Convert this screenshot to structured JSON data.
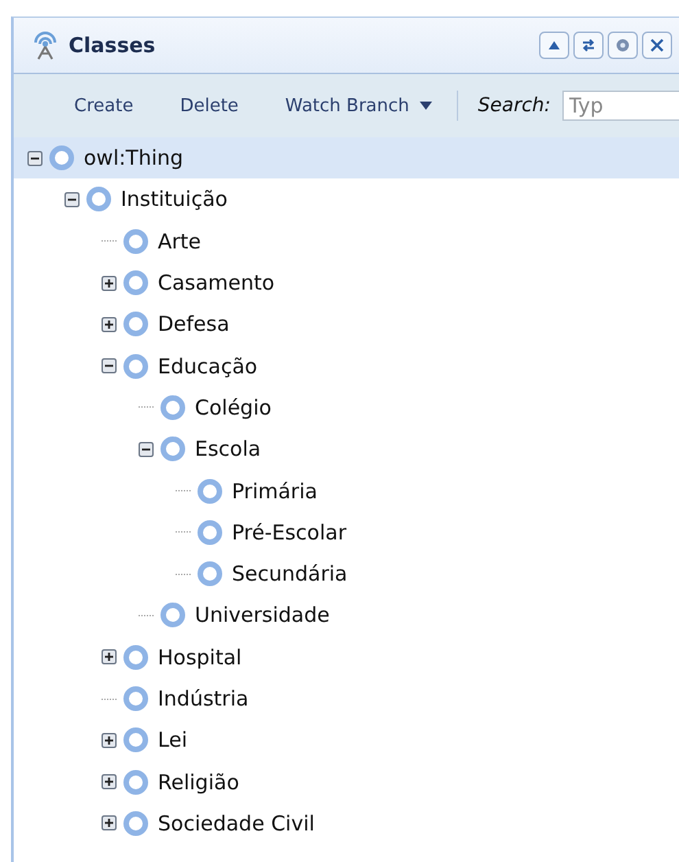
{
  "panel": {
    "title": "Classes"
  },
  "toolbar": {
    "buttons": [
      "Create",
      "Delete"
    ],
    "watch_branch": "Watch Branch",
    "search_label": "Search:",
    "search_placeholder": "Typ"
  },
  "tree": [
    {
      "label": "owl:Thing",
      "kind": "branch",
      "expanded": true,
      "selected": true,
      "children": [
        {
          "label": "Instituição",
          "kind": "branch",
          "expanded": true,
          "selected": false,
          "children": [
            {
              "label": "Arte",
              "kind": "leaf",
              "selected": false
            },
            {
              "label": "Casamento",
              "kind": "branch",
              "expanded": false,
              "selected": false
            },
            {
              "label": "Defesa",
              "kind": "branch",
              "expanded": false,
              "selected": false
            },
            {
              "label": "Educação",
              "kind": "branch",
              "expanded": true,
              "selected": false,
              "children": [
                {
                  "label": "Colégio",
                  "kind": "leaf",
                  "selected": false
                },
                {
                  "label": "Escola",
                  "kind": "branch",
                  "expanded": true,
                  "selected": false,
                  "children": [
                    {
                      "label": "Primária",
                      "kind": "leaf",
                      "selected": false
                    },
                    {
                      "label": "Pré-Escolar",
                      "kind": "leaf",
                      "selected": false
                    },
                    {
                      "label": "Secundária",
                      "kind": "leaf",
                      "selected": false
                    }
                  ]
                },
                {
                  "label": "Universidade",
                  "kind": "leaf",
                  "selected": false
                }
              ]
            },
            {
              "label": "Hospital",
              "kind": "branch",
              "expanded": false,
              "selected": false
            },
            {
              "label": "Indústria",
              "kind": "leaf",
              "selected": false
            },
            {
              "label": "Lei",
              "kind": "branch",
              "expanded": false,
              "selected": false
            },
            {
              "label": "Religião",
              "kind": "branch",
              "expanded": false,
              "selected": false
            },
            {
              "label": "Sociedade Civil",
              "kind": "branch",
              "expanded": false,
              "selected": false
            }
          ]
        }
      ]
    }
  ]
}
